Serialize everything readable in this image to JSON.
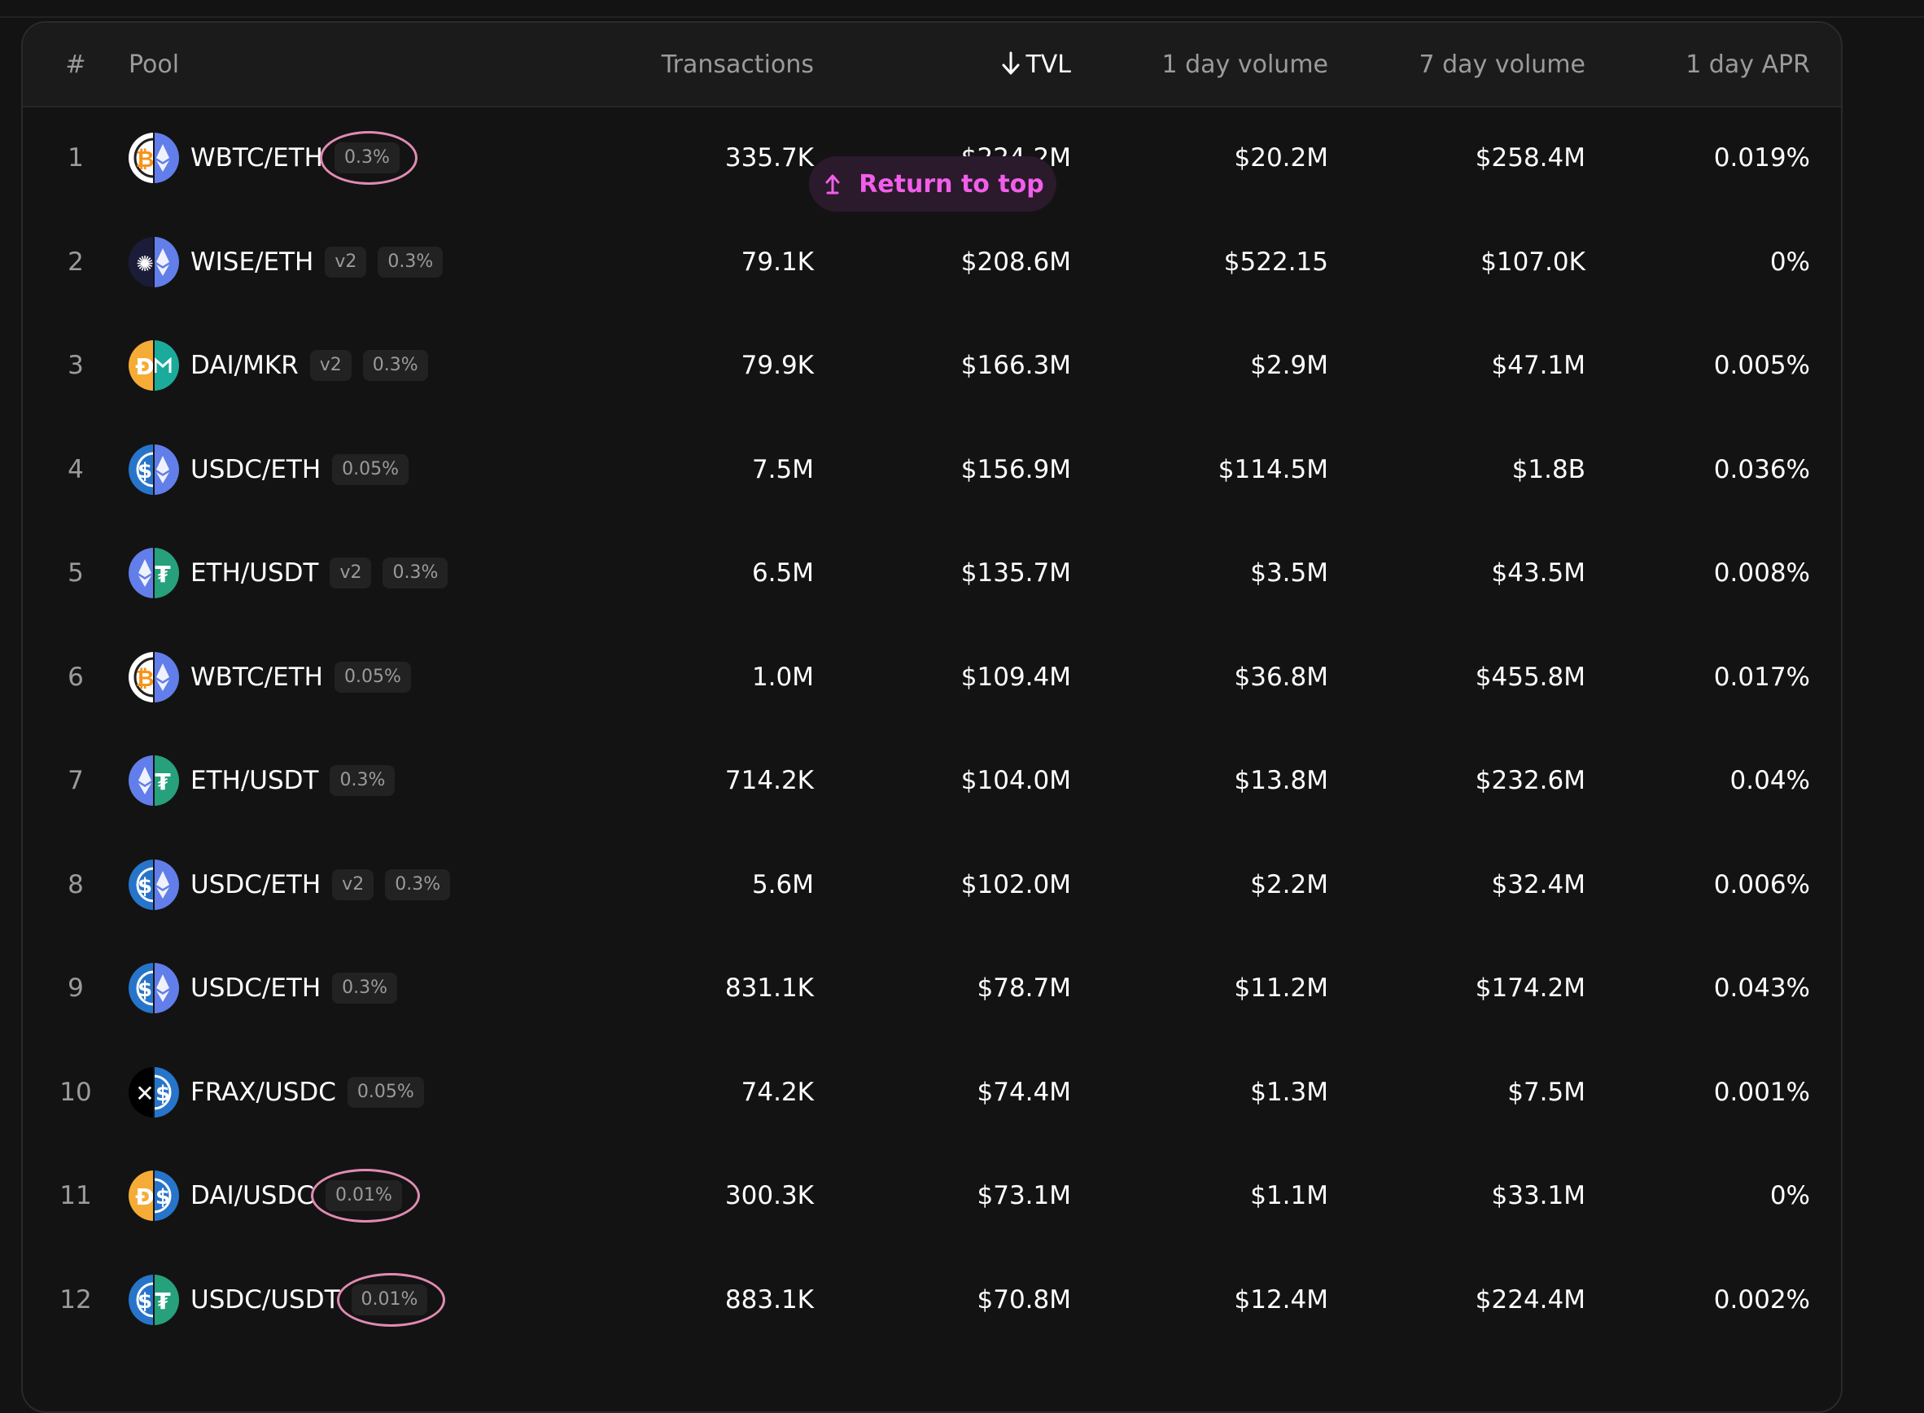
{
  "headers": {
    "index": "#",
    "pool": "Pool",
    "transactions": "Transactions",
    "tvl": "TVL",
    "vol1d": "1 day volume",
    "vol7d": "7 day volume",
    "apr1d": "1 day APR"
  },
  "toast": {
    "label": "Return to top"
  },
  "colors": {
    "eth": "#627eea",
    "btc": "#f7931a",
    "usdc": "#2775ca",
    "usdt": "#26a17b",
    "dai": "#f5ac37",
    "mkr": "#1aab9b",
    "frax": "#000000",
    "wise": "#1b1c39",
    "accent": "#f15eea"
  },
  "rows": [
    {
      "idx": "1",
      "pair": "WBTC/ETH",
      "version": "",
      "fee": "0.3%",
      "circled": true,
      "icons": [
        "btc-wrapped",
        "eth"
      ],
      "tx": "335.7K",
      "tvl": "$224.2M",
      "vol1d": "$20.2M",
      "vol7d": "$258.4M",
      "apr": "0.019%"
    },
    {
      "idx": "2",
      "pair": "WISE/ETH",
      "version": "v2",
      "fee": "0.3%",
      "circled": false,
      "icons": [
        "wise",
        "eth"
      ],
      "tx": "79.1K",
      "tvl": "$208.6M",
      "vol1d": "$522.15",
      "vol7d": "$107.0K",
      "apr": "0%"
    },
    {
      "idx": "3",
      "pair": "DAI/MKR",
      "version": "v2",
      "fee": "0.3%",
      "circled": false,
      "icons": [
        "dai",
        "mkr"
      ],
      "tx": "79.9K",
      "tvl": "$166.3M",
      "vol1d": "$2.9M",
      "vol7d": "$47.1M",
      "apr": "0.005%"
    },
    {
      "idx": "4",
      "pair": "USDC/ETH",
      "version": "",
      "fee": "0.05%",
      "circled": false,
      "icons": [
        "usdc",
        "eth"
      ],
      "tx": "7.5M",
      "tvl": "$156.9M",
      "vol1d": "$114.5M",
      "vol7d": "$1.8B",
      "apr": "0.036%"
    },
    {
      "idx": "5",
      "pair": "ETH/USDT",
      "version": "v2",
      "fee": "0.3%",
      "circled": false,
      "icons": [
        "eth",
        "usdt"
      ],
      "tx": "6.5M",
      "tvl": "$135.7M",
      "vol1d": "$3.5M",
      "vol7d": "$43.5M",
      "apr": "0.008%"
    },
    {
      "idx": "6",
      "pair": "WBTC/ETH",
      "version": "",
      "fee": "0.05%",
      "circled": false,
      "icons": [
        "btc-wrapped",
        "eth"
      ],
      "tx": "1.0M",
      "tvl": "$109.4M",
      "vol1d": "$36.8M",
      "vol7d": "$455.8M",
      "apr": "0.017%"
    },
    {
      "idx": "7",
      "pair": "ETH/USDT",
      "version": "",
      "fee": "0.3%",
      "circled": false,
      "icons": [
        "eth",
        "usdt"
      ],
      "tx": "714.2K",
      "tvl": "$104.0M",
      "vol1d": "$13.8M",
      "vol7d": "$232.6M",
      "apr": "0.04%"
    },
    {
      "idx": "8",
      "pair": "USDC/ETH",
      "version": "v2",
      "fee": "0.3%",
      "circled": false,
      "icons": [
        "usdc",
        "eth"
      ],
      "tx": "5.6M",
      "tvl": "$102.0M",
      "vol1d": "$2.2M",
      "vol7d": "$32.4M",
      "apr": "0.006%"
    },
    {
      "idx": "9",
      "pair": "USDC/ETH",
      "version": "",
      "fee": "0.3%",
      "circled": false,
      "icons": [
        "usdc",
        "eth"
      ],
      "tx": "831.1K",
      "tvl": "$78.7M",
      "vol1d": "$11.2M",
      "vol7d": "$174.2M",
      "apr": "0.043%"
    },
    {
      "idx": "10",
      "pair": "FRAX/USDC",
      "version": "",
      "fee": "0.05%",
      "circled": false,
      "icons": [
        "frax",
        "usdc"
      ],
      "tx": "74.2K",
      "tvl": "$74.4M",
      "vol1d": "$1.3M",
      "vol7d": "$7.5M",
      "apr": "0.001%"
    },
    {
      "idx": "11",
      "pair": "DAI/USDC",
      "version": "",
      "fee": "0.01%",
      "circled": true,
      "icons": [
        "dai",
        "usdc"
      ],
      "tx": "300.3K",
      "tvl": "$73.1M",
      "vol1d": "$1.1M",
      "vol7d": "$33.1M",
      "apr": "0%"
    },
    {
      "idx": "12",
      "pair": "USDC/USDT",
      "version": "",
      "fee": "0.01%",
      "circled": true,
      "icons": [
        "usdc",
        "usdt"
      ],
      "tx": "883.1K",
      "tvl": "$70.8M",
      "vol1d": "$12.4M",
      "vol7d": "$224.4M",
      "apr": "0.002%"
    }
  ]
}
